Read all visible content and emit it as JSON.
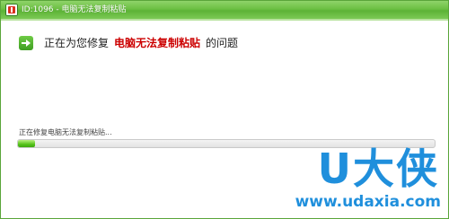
{
  "window": {
    "title": "ID:1096 - 电脑无法复制粘贴",
    "app_icon": "repair-app-icon"
  },
  "step": {
    "icon": "arrow-right-icon",
    "prefix": "正在为您修复",
    "highlight": "电脑无法复制粘贴",
    "suffix": "的问题"
  },
  "status": {
    "text": "正在修复电脑无法复制粘贴..."
  },
  "progress": {
    "percent": 4
  },
  "watermark": {
    "main": "U大侠",
    "url": "www.udaxia.com"
  },
  "colors": {
    "titlebar": "#6cc043",
    "highlight": "#cc0000",
    "progress": "#55c21b",
    "watermark": "#1f8fdc"
  }
}
